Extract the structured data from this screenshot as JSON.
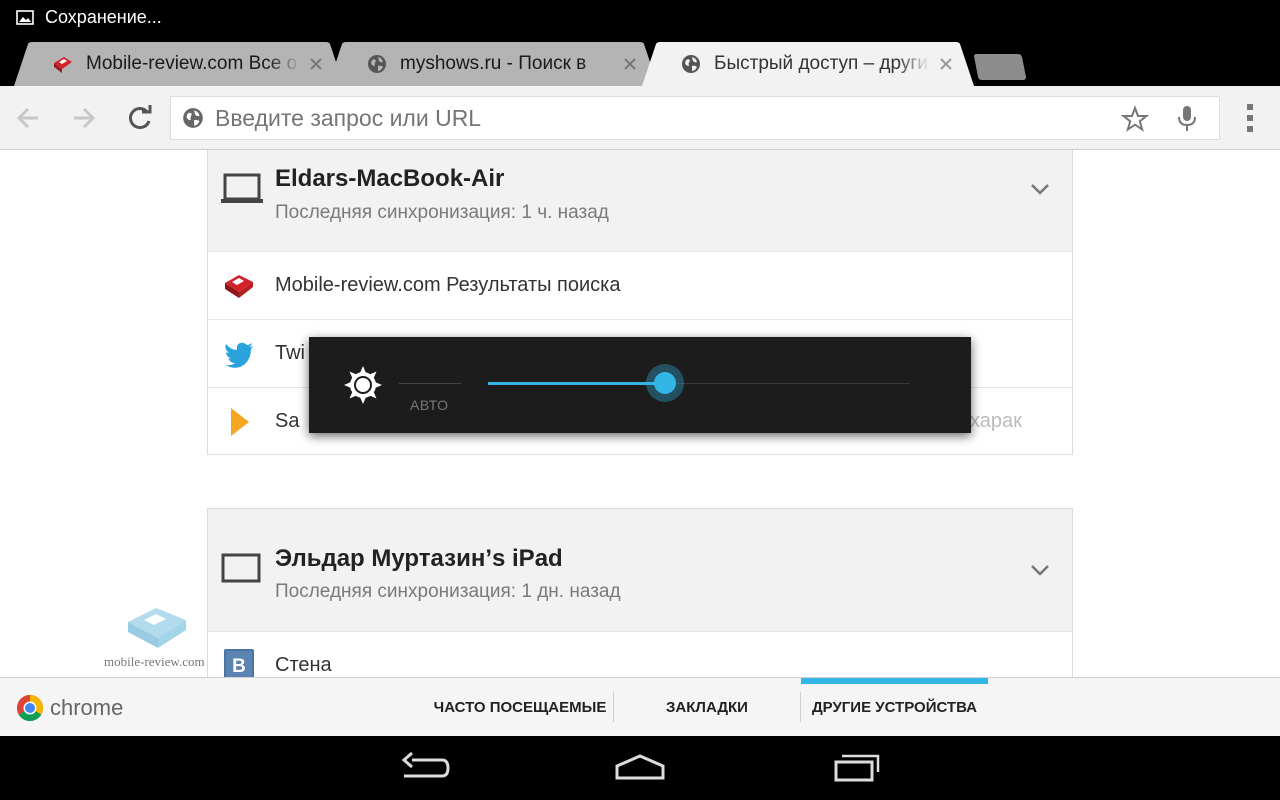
{
  "status_bar": {
    "text": "Сохранение...",
    "icon": "image-icon"
  },
  "tabs": [
    {
      "title": "Mobile-review.com Все о",
      "favicon": "mobile-review-icon",
      "active": false
    },
    {
      "title": "myshows.ru - Поиск в",
      "favicon": "globe-icon",
      "active": false
    },
    {
      "title": "Быстрый доступ – други",
      "favicon": "globe-icon",
      "active": true
    }
  ],
  "toolbar": {
    "placeholder": "Введите запрос или URL",
    "back_icon": "back-arrow-icon",
    "forward_icon": "forward-arrow-icon",
    "reload_icon": "reload-icon",
    "star_icon": "star-icon",
    "mic_icon": "mic-icon",
    "menu_icon": "overflow-menu-icon"
  },
  "devices": [
    {
      "name": "Eldars-MacBook-Air",
      "sync": "Последняя синхронизация: 1 ч. назад",
      "icon": "laptop-icon",
      "items": [
        {
          "label": "Mobile-review.com Результаты поиска",
          "icon": "mobile-review-icon"
        },
        {
          "label": "Twi",
          "icon": "twitter-bird-icon"
        },
        {
          "label": "Sa",
          "label_tail": "харак",
          "icon": "play-triangle-icon"
        }
      ]
    },
    {
      "name": "Эльдар Муртазин’s iPad",
      "sync": "Последняя синхронизация: 1 дн. назад",
      "icon": "tablet-icon",
      "items": [
        {
          "label": "Стена",
          "icon": "vk-icon"
        }
      ]
    }
  ],
  "brightness": {
    "auto_label": "АВТО",
    "level": 0.42
  },
  "watermark": {
    "text": "mobile-review.com"
  },
  "bottom_bar": {
    "brand": "chrome",
    "tabs": [
      {
        "label": "ЧАСТО ПОСЕЩАЕМЫЕ",
        "selected": false
      },
      {
        "label": "ЗАКЛАДКИ",
        "selected": false
      },
      {
        "label": "ДРУГИЕ УСТРОЙСТВА",
        "selected": true
      }
    ]
  },
  "colors": {
    "accent": "#33b5e5",
    "tab_active": "#f2f2f2",
    "tab_inactive": "#b4b4b4"
  }
}
